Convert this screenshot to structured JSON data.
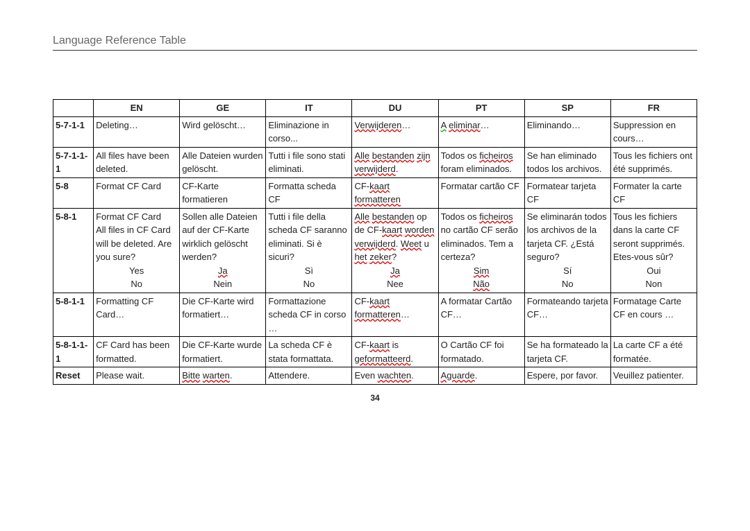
{
  "title": "Language Reference Table",
  "page_number": "34",
  "headers": [
    "",
    "EN",
    "GE",
    "IT",
    "DU",
    "PT",
    "SP",
    "FR"
  ],
  "rows": [
    {
      "id": "5-7-1-1",
      "en": "Deleting…",
      "ge": "Wird gelöscht…",
      "it": "Eliminazione in corso...",
      "du_html": "<span class='sq'>Verwijderen</span>…",
      "pt_html": "<span class='sg'>A</span> <span class='sq'>eliminar</span>…",
      "sp": "Eliminando…",
      "fr": "Suppression en cours…"
    },
    {
      "id": "5-7-1-1-1",
      "en": "All files have been deleted.",
      "ge": "Alle Dateien wurden gelöscht.",
      "it": "Tutti i file sono stati eliminati.",
      "du_html": "<span class='sq'>Alle</span> <span class='sq'>bestanden</span> <span class='sq'>zijn</span> <span class='sq'>verwijderd</span>.",
      "pt_html": "Todos os <span class='sq'>ficheiros</span> foram eliminados.",
      "sp": "Se han eliminado todos los archivos.",
      "fr": "Tous les fichiers ont été supprimés."
    },
    {
      "id": "5-8",
      "en": "Format CF Card",
      "ge": "CF-Karte formatieren",
      "it": "Formatta scheda CF",
      "du_html": "CF-<span class='sq'>kaart</span> <span class='sq'>formatteren</span>",
      "pt_html": "Formatar cartão CF",
      "sp": "Formatear tarjeta CF",
      "fr": "Formater la carte CF"
    },
    {
      "id": "5-8-1",
      "en_html": "Format CF Card<br>All files in CF Card will be deleted. Are you sure?<br><span class='ctr'>Yes</span><span class='ctr'>No</span>",
      "ge_html": "Sollen alle Dateien auf der CF-Karte wirklich gelöscht werden?<br><span class='ctr'><span class='sq'>Ja</span></span><span class='ctr'>Nein</span>",
      "it_html": "Tutti i file della scheda CF saranno eliminati. Si è sicuri?<br><span class='ctr'>Sì</span><span class='ctr'>No</span>",
      "du_html": "<span class='sq'>Alle</span> <span class='sq'>bestanden</span> op de CF-<span class='sq'>kaart</span> <span class='sq'>worden</span> <span class='sq'>verwijderd</span>. <span class='sq'>Weet</span> u <span class='sq'>het</span> <span class='sq'>zeker</span>?<br><span class='ctr'><span class='sq'>Ja</span></span><span class='ctr'>Nee</span>",
      "pt_html": "Todos os <span class='sq'>ficheiros</span> no cartão CF serão eliminados. Tem a certeza?<br><span class='ctr'><span class='sq'>Sim</span></span><span class='ctr'><span class='sq'>Não</span></span>",
      "sp_html": "Se eliminarán todos los archivos de la tarjeta CF. ¿Está seguro?<br><span class='ctr'>Sí</span><span class='ctr'>No</span>",
      "fr_html": "Tous les fichiers dans la carte CF seront supprimés. Etes-vous sûr?<br><span class='ctr'>Oui</span><span class='ctr'>Non</span>"
    },
    {
      "id": "5-8-1-1",
      "en": "Formatting CF Card…",
      "ge": "Die CF-Karte wird formatiert…",
      "it": "Formattazione scheda CF in corso …",
      "du_html": "CF-<span class='sq'>kaart</span> <span class='sq'>formatteren</span>…",
      "pt_html": "A formatar Cartão CF…",
      "sp": "Formateando tarjeta CF…",
      "fr": "Formatage Carte CF en cours …"
    },
    {
      "id": "5-8-1-1-1",
      "en": "CF Card has been formatted.",
      "ge": "Die CF-Karte wurde formatiert.",
      "it": "La scheda CF è stata formattata.",
      "du_html": "CF-<span class='sq'>kaart</span> is <span class='sq'>geformatteerd</span>.",
      "pt_html": "O Cartão CF foi formatado.",
      "sp": "Se ha formateado la tarjeta CF.",
      "fr": "La carte CF a été formatée."
    },
    {
      "id": "Reset",
      "en": "Please wait.",
      "ge_html": "<span class='sq'>Bitte</span> <span class='sq'>warten</span>.",
      "it": "Attendere.",
      "du_html": "Even <span class='sq'>wachten</span>.",
      "pt_html": "<span class='sq'>Aguarde</span>.",
      "sp": "Espere, por favor.",
      "fr": "Veuillez patienter."
    }
  ]
}
